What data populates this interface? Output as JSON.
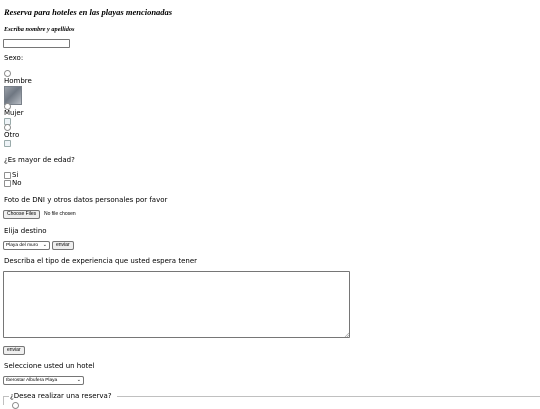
{
  "form": {
    "title": "Reserva para hoteles en las playas mencionadas",
    "name_label": "Escriba nombre y apellidos",
    "name_value": "",
    "sex_label": "Sexo:",
    "sex_options": [
      "Hombre",
      "Mujer",
      "Otro"
    ],
    "age_question": "¿Es mayor de edad?",
    "age_options": [
      "Si",
      "No"
    ],
    "dni_label": "Foto de DNI y otros datos personales por favor",
    "file_button": "Choose Files",
    "file_status": "No file chosen",
    "destination_label": "Elija destino",
    "destination_selected": "Playa del muro",
    "send_label": "enviar",
    "experience_label": "Describa el tipo de experiencia que usted espera tener",
    "experience_value": "",
    "hotel_label": "Seleccione usted un hotel",
    "hotel_selected": "Iberostar Albufera Playa",
    "reserve_legend": "¿Desea realizar una reserva?"
  },
  "icons": {
    "dropdown": "chevron-down-icon",
    "broken_image": "broken-image-icon",
    "resize": "resize-handle-icon"
  }
}
